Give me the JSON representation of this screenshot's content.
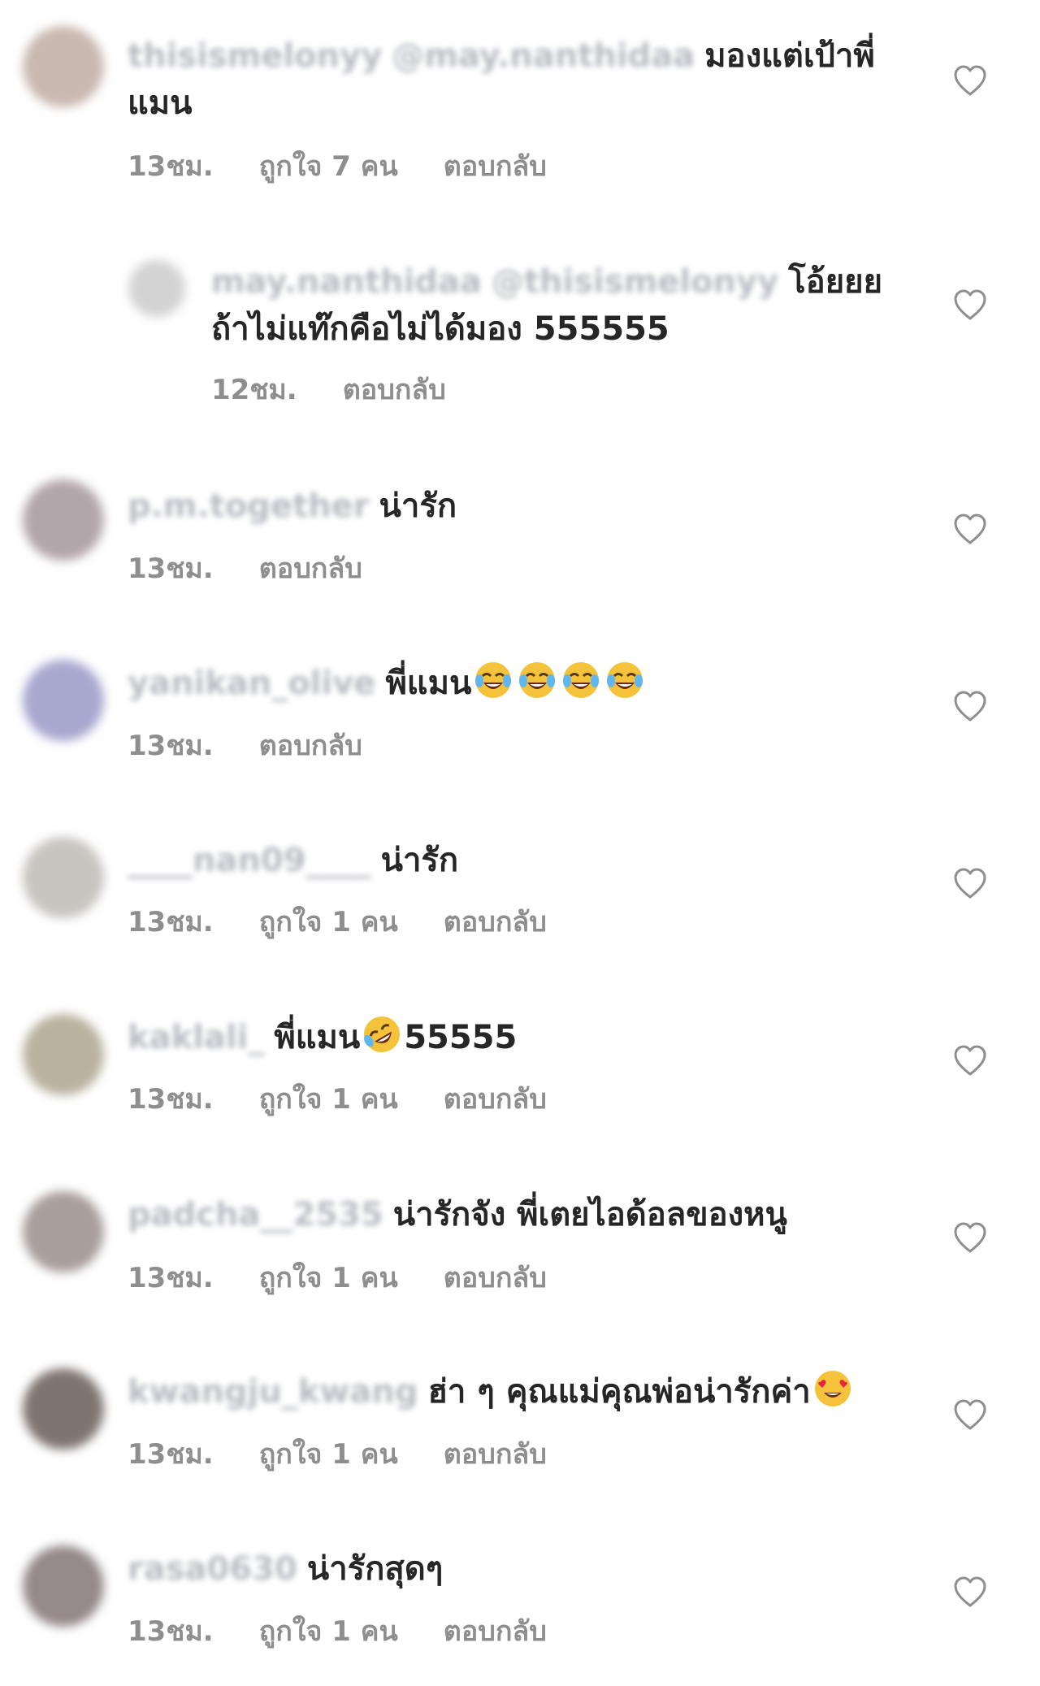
{
  "comments": [
    {
      "username": "thisismelonyy",
      "mention": "@may.nanthidaa",
      "text": "มองแต่เป้าพี่แมน",
      "time": "13ชม.",
      "likes": "ถูกใจ 7 คน",
      "reply": "ตอบกลับ",
      "avatar_color": "#c9b8b0"
    },
    {
      "username": "may.nanthidaa",
      "mention": "@thisismelonyy",
      "text": "โอ้ยยย ถ้าไม่แท๊กคือไม่ได้มอง 555555",
      "time": "12ชม.",
      "likes": "",
      "reply": "ตอบกลับ",
      "avatar_color": "#d3d3d3"
    },
    {
      "username": "p.m.together",
      "mention": "",
      "text": "น่ารัก",
      "time": "13ชม.",
      "likes": "",
      "reply": "ตอบกลับ",
      "avatar_color": "#b3a6ab"
    },
    {
      "username": "yanikan_olive",
      "mention": "",
      "text": "พี่แมน",
      "emoji": [
        "face-with-tears-of-joy",
        "face-with-tears-of-joy",
        "face-with-tears-of-joy",
        "face-with-tears-of-joy"
      ],
      "time": "13ชม.",
      "likes": "",
      "reply": "ตอบกลับ",
      "avatar_color": "#a8a7cf"
    },
    {
      "username": "____nan09____",
      "mention": "",
      "text": "น่ารัก",
      "time": "13ชม.",
      "likes": "ถูกใจ 1 คน",
      "reply": "ตอบกลับ",
      "avatar_color": "#c8c4bf"
    },
    {
      "username": "kaklali_",
      "mention": "",
      "text": "พี่แมน",
      "emoji": [
        "rolling-on-the-floor-laughing"
      ],
      "text_after": "55555",
      "time": "13ชม.",
      "likes": "ถูกใจ 1 คน",
      "reply": "ตอบกลับ",
      "avatar_color": "#b9b29f"
    },
    {
      "username": "padcha__2535",
      "mention": "",
      "text": "น่ารักจัง พี่เตยไอด้อลของหนู",
      "time": "13ชม.",
      "likes": "ถูกใจ 1 คน",
      "reply": "ตอบกลับ",
      "avatar_color": "#a89e9b"
    },
    {
      "username": "kwangju_kwang",
      "mention": "",
      "text": "ฮ่า ๆ คุณแม่คุณพ่อน่ารักค่า",
      "emoji": [
        "smiling-face-with-heart-eyes"
      ],
      "time": "13ชม.",
      "likes": "ถูกใจ 1 คน",
      "reply": "ตอบกลับ",
      "avatar_color": "#7f7570"
    },
    {
      "username": "rasa0630",
      "mention": "",
      "text": "น่ารักสุดๆ",
      "time": "13ชม.",
      "likes": "ถูกใจ 1 คน",
      "reply": "ตอบกลับ",
      "avatar_color": "#94898b"
    }
  ],
  "icons": {
    "like": "heart-outline-icon"
  },
  "colors": {
    "text": "#262626",
    "meta": "#8e8e8e",
    "username_blurred": "#b9bcc4",
    "icon": "#8e8e8e"
  }
}
